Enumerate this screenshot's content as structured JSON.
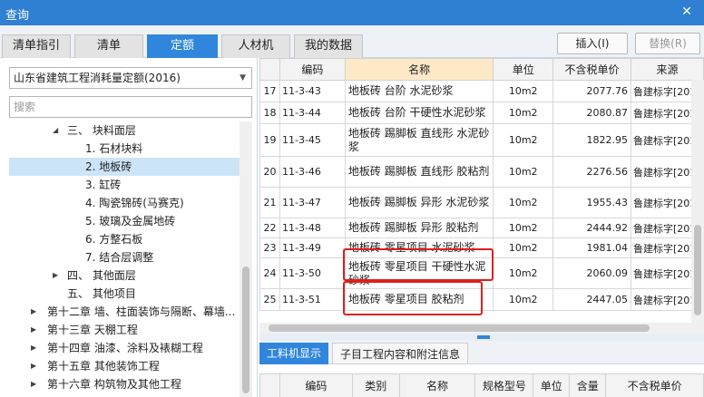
{
  "window": {
    "title": "查询",
    "close_icon": "close-icon"
  },
  "tabs": [
    {
      "label": "清单指引",
      "active": false
    },
    {
      "label": "清单",
      "active": false
    },
    {
      "label": "定额",
      "active": true
    },
    {
      "label": "人材机",
      "active": false
    },
    {
      "label": "我的数据",
      "active": false
    }
  ],
  "buttons": {
    "insert": "插入(I)",
    "replace": "替换(R)"
  },
  "left_panel": {
    "quota_select": "山东省建筑工程消耗量定额(2016)",
    "search_placeholder": "搜索",
    "tree": [
      {
        "label": "三、 块料面层",
        "caret": "expanded",
        "selected": false
      },
      {
        "label": "1. 石材块料",
        "caret": "",
        "selected": false
      },
      {
        "label": "2. 地板砖",
        "caret": "",
        "selected": true
      },
      {
        "label": "3. 缸砖",
        "caret": "",
        "selected": false
      },
      {
        "label": "4. 陶瓷锦砖(马赛克)",
        "caret": "",
        "selected": false
      },
      {
        "label": "5. 玻璃及金属地砖",
        "caret": "",
        "selected": false
      },
      {
        "label": "6. 方整石板",
        "caret": "",
        "selected": false
      },
      {
        "label": "7. 结合层调整",
        "caret": "",
        "selected": false
      },
      {
        "label": "四、 其他面层",
        "caret": "collapsed",
        "selected": false
      },
      {
        "label": "五、 其他项目",
        "caret": "",
        "selected": false
      },
      {
        "label": "第十二章 墙、柱面装饰与隔断、幕墙...",
        "caret": "collapsed",
        "selected": false
      },
      {
        "label": "第十三章 天棚工程",
        "caret": "collapsed",
        "selected": false
      },
      {
        "label": "第十四章 油漆、涂料及裱糊工程",
        "caret": "collapsed",
        "selected": false
      },
      {
        "label": "第十五章 其他装饰工程",
        "caret": "collapsed",
        "selected": false
      },
      {
        "label": "第十六章 构筑物及其他工程",
        "caret": "collapsed",
        "selected": false
      }
    ]
  },
  "grid": {
    "columns": [
      "",
      "编码",
      "名称",
      "单位",
      "不含税单价",
      "来源"
    ],
    "rows": [
      {
        "idx": "17",
        "code": "11-3-43",
        "name": "地板砖 台阶 水泥砂浆",
        "unit": "10m2",
        "price": "2077.76",
        "source": "鲁建标字[201"
      },
      {
        "idx": "18",
        "code": "11-3-44",
        "name": "地板砖 台阶 干硬性水泥砂浆",
        "unit": "10m2",
        "price": "2080.87",
        "source": "鲁建标字[201"
      },
      {
        "idx": "19",
        "code": "11-3-45",
        "name": "地板砖 踢脚板 直线形 水泥砂浆",
        "unit": "10m2",
        "price": "1822.95",
        "source": "鲁建标字[201"
      },
      {
        "idx": "20",
        "code": "11-3-46",
        "name": "地板砖 踢脚板 直线形 胶粘剂",
        "unit": "10m2",
        "price": "2276.56",
        "source": "鲁建标字[201"
      },
      {
        "idx": "21",
        "code": "11-3-47",
        "name": "地板砖 踢脚板 异形 水泥砂浆",
        "unit": "10m2",
        "price": "1955.43",
        "source": "鲁建标字[201"
      },
      {
        "idx": "22",
        "code": "11-3-48",
        "name": "地板砖 踢脚板 异形 胶粘剂",
        "unit": "10m2",
        "price": "2444.92",
        "source": "鲁建标字[201"
      },
      {
        "idx": "23",
        "code": "11-3-49",
        "name": "地板砖 零星项目 水泥砂浆",
        "unit": "10m2",
        "price": "1981.04",
        "source": "鲁建标字[201"
      },
      {
        "idx": "24",
        "code": "11-3-50",
        "name": "地板砖 零星项目 干硬性水泥砂浆",
        "unit": "10m2",
        "price": "2060.09",
        "source": "鲁建标字[201"
      },
      {
        "idx": "25",
        "code": "11-3-51",
        "name": "地板砖 零星项目 胶粘剂",
        "unit": "10m2",
        "price": "2447.05",
        "source": "鲁建标字[201"
      }
    ]
  },
  "bottom_tabs": [
    {
      "label": "工料机显示",
      "active": true
    },
    {
      "label": "子目工程内容和附注信息",
      "active": false
    }
  ],
  "bottom_grid": {
    "columns": [
      "",
      "编码",
      "类别",
      "名称",
      "规格型号",
      "单位",
      "含量",
      "不含税单价"
    ]
  },
  "colors": {
    "titlebar": "#2f7fd2",
    "active_tab": "#2f86dc",
    "selected_row": "#cce4f7",
    "highlight_header": "#fde9c6",
    "annotation_box": "#e01e1e"
  }
}
